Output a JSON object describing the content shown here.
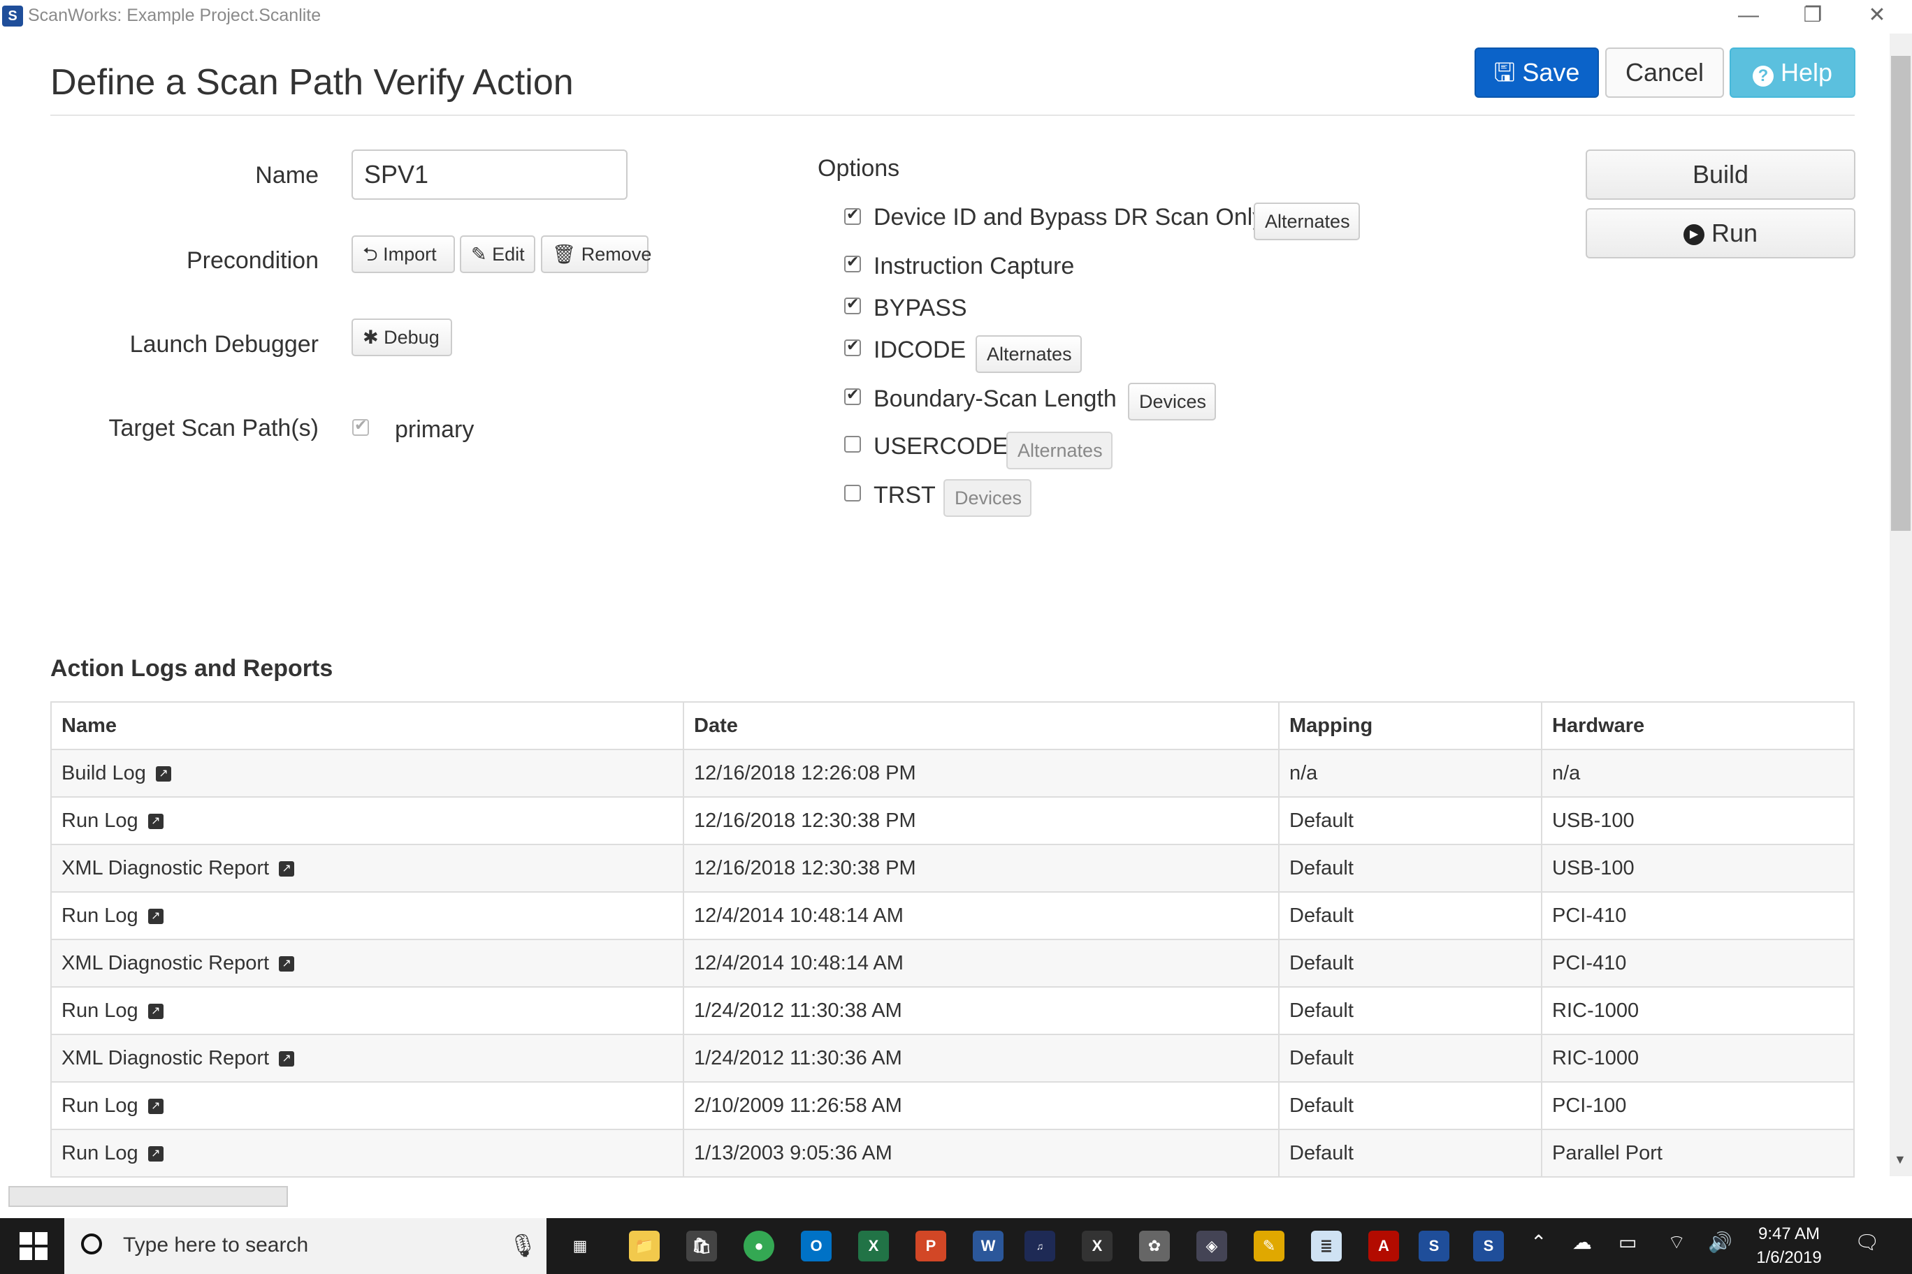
{
  "window": {
    "title": "ScanWorks: Example Project.Scanlite",
    "minimize": "—",
    "restore": "❐",
    "close": "✕"
  },
  "header": {
    "title": "Define a Scan Path Verify Action",
    "save": "Save",
    "cancel": "Cancel",
    "help": "Help"
  },
  "side": {
    "build": "Build",
    "run": "Run"
  },
  "form": {
    "name_label": "Name",
    "name_value": "SPV1",
    "precondition_label": "Precondition",
    "import": "Import",
    "edit": "Edit",
    "remove": "Remove",
    "debugger_label": "Launch Debugger",
    "debug": "Debug",
    "target_label": "Target Scan Path(s)",
    "target_value": "primary"
  },
  "options": {
    "title": "Options",
    "items": [
      {
        "label": "Device ID and Bypass DR Scan Only",
        "checked": true,
        "button": "Alternates"
      },
      {
        "label": "Instruction Capture",
        "checked": true
      },
      {
        "label": "BYPASS",
        "checked": true
      },
      {
        "label": "IDCODE",
        "checked": true,
        "button": "Alternates"
      },
      {
        "label": "Boundary-Scan Length",
        "checked": true,
        "button": "Devices"
      },
      {
        "label": "USERCODE",
        "checked": false,
        "button": "Alternates"
      },
      {
        "label": "TRST",
        "checked": false,
        "button": "Devices"
      }
    ]
  },
  "logs": {
    "title": "Action Logs and Reports",
    "columns": [
      "Name",
      "Date",
      "Mapping",
      "Hardware"
    ],
    "rows": [
      {
        "name": "Build Log",
        "date": "12/16/2018 12:26:08 PM",
        "mapping": "n/a",
        "hardware": "n/a"
      },
      {
        "name": "Run Log",
        "date": "12/16/2018 12:30:38 PM",
        "mapping": "Default",
        "hardware": "USB-100"
      },
      {
        "name": "XML Diagnostic Report",
        "date": "12/16/2018 12:30:38 PM",
        "mapping": "Default",
        "hardware": "USB-100"
      },
      {
        "name": "Run Log",
        "date": "12/4/2014 10:48:14 AM",
        "mapping": "Default",
        "hardware": "PCI-410"
      },
      {
        "name": "XML Diagnostic Report",
        "date": "12/4/2014 10:48:14 AM",
        "mapping": "Default",
        "hardware": "PCI-410"
      },
      {
        "name": "Run Log",
        "date": "1/24/2012 11:30:38 AM",
        "mapping": "Default",
        "hardware": "RIC-1000"
      },
      {
        "name": "XML Diagnostic Report",
        "date": "1/24/2012 11:30:36 AM",
        "mapping": "Default",
        "hardware": "RIC-1000"
      },
      {
        "name": "Run Log",
        "date": "2/10/2009 11:26:58 AM",
        "mapping": "Default",
        "hardware": "PCI-100"
      },
      {
        "name": "Run Log",
        "date": "1/13/2003 9:05:36 AM",
        "mapping": "Default",
        "hardware": "Parallel Port"
      }
    ]
  },
  "taskbar": {
    "search_placeholder": "Type here to search",
    "time": "9:47 AM",
    "date": "1/6/2019"
  }
}
